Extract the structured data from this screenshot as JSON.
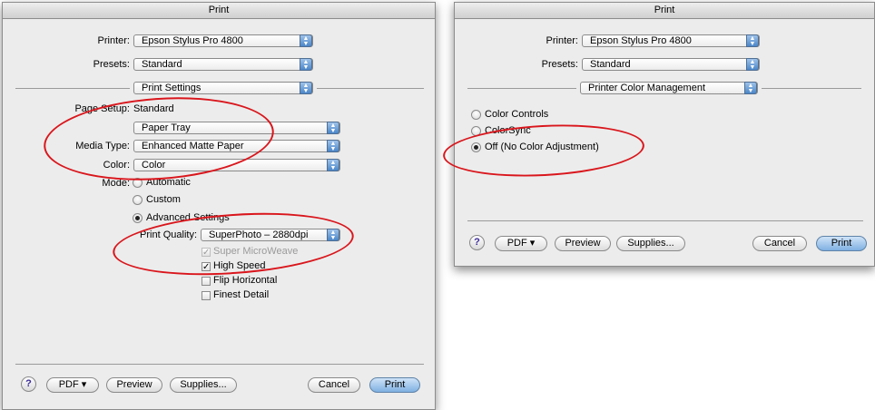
{
  "left": {
    "title": "Print",
    "printer_label": "Printer:",
    "printer_value": "Epson Stylus Pro 4800",
    "presets_label": "Presets:",
    "presets_value": "Standard",
    "panel_value": "Print Settings",
    "page_setup_label": "Page Setup:",
    "page_setup_value": "Standard",
    "source_value": "Paper Tray",
    "media_label": "Media Type:",
    "media_value": "Enhanced Matte Paper",
    "color_label": "Color:",
    "color_value": "Color",
    "mode_label": "Mode:",
    "mode_options": [
      "Automatic",
      "Custom",
      "Advanced Settings"
    ],
    "mode_selected": "Advanced Settings",
    "quality_label": "Print Quality:",
    "quality_value": "SuperPhoto – 2880dpi",
    "checks": [
      {
        "label": "Super MicroWeave",
        "checked": true,
        "enabled": false
      },
      {
        "label": "High Speed",
        "checked": true,
        "enabled": true
      },
      {
        "label": "Flip Horizontal",
        "checked": false,
        "enabled": true
      },
      {
        "label": "Finest Detail",
        "checked": false,
        "enabled": true
      }
    ],
    "buttons": {
      "help": "?",
      "pdf": "PDF ▾",
      "preview": "Preview",
      "supplies": "Supplies...",
      "cancel": "Cancel",
      "print": "Print"
    }
  },
  "right": {
    "title": "Print",
    "printer_label": "Printer:",
    "printer_value": "Epson Stylus Pro 4800",
    "presets_label": "Presets:",
    "presets_value": "Standard",
    "panel_value": "Printer Color Management",
    "options": [
      "Color Controls",
      "ColorSync",
      "Off (No Color Adjustment)"
    ],
    "selected": "Off (No Color Adjustment)",
    "buttons": {
      "help": "?",
      "pdf": "PDF ▾",
      "preview": "Preview",
      "supplies": "Supplies...",
      "cancel": "Cancel",
      "print": "Print"
    }
  },
  "colors": {
    "highlight_ellipse": "#d9161c",
    "default_button": "#7fb0e2",
    "dialog_bg": "#ececec"
  }
}
